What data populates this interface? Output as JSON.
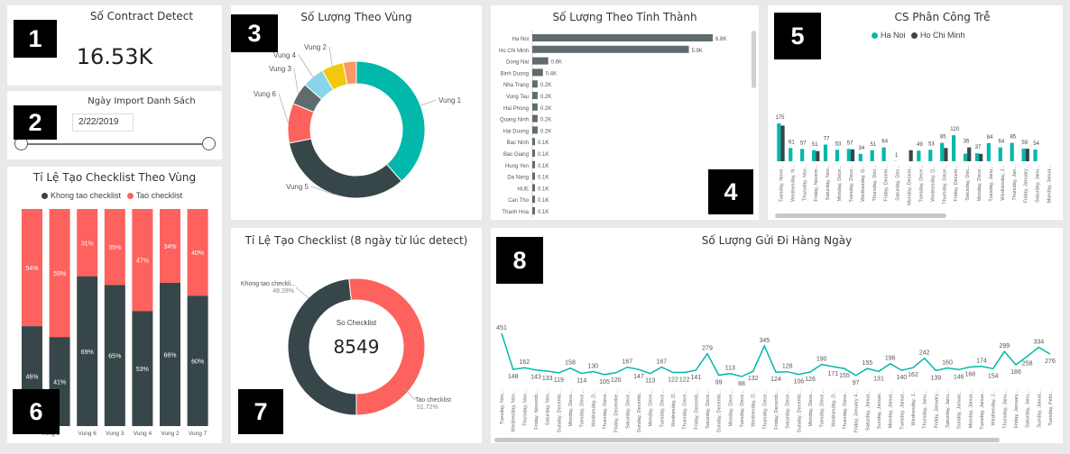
{
  "colors": {
    "teal": "#01B8AA",
    "dark": "#374649",
    "red": "#FD625E",
    "yellow": "#F2C80F",
    "lightblue": "#8AD4EB",
    "orange": "#FE9666",
    "grey": "#5F6B6D"
  },
  "badges": [
    "1",
    "2",
    "3",
    "4",
    "5",
    "6",
    "7",
    "8"
  ],
  "kpi": {
    "title": "Số Contract Detect",
    "value": "16.53K"
  },
  "slicer": {
    "title": "Ngày Import Danh Sách",
    "start_partial": "18",
    "end_date": "2/22/2019",
    "start_level": 0,
    "end_level": 1
  },
  "vung": {
    "title": "Số Lượng Theo Vùng",
    "chart_data": {
      "type": "pie",
      "labels": [
        "Vung 1",
        "Vung 5",
        "Vung 6",
        "Vung 3",
        "Vung 4",
        "Vung 2",
        "Vung 7"
      ],
      "values": [
        37,
        32,
        9,
        5,
        5,
        5,
        3
      ]
    }
  },
  "tinh": {
    "title": "Số Lượng Theo Tỉnh Thành",
    "chart_data": {
      "type": "bar",
      "categories": [
        "Ha Noi",
        "Ho Chi Minh",
        "Dong Nai",
        "Binh Duong",
        "Nha Trang",
        "Vung Tau",
        "Hai Phong",
        "Quang Ninh",
        "Hai Duong",
        "Bac Ninh",
        "Bac Giang",
        "Hung Yen",
        "Da Nang",
        "HUE",
        "Can Tho",
        "Thanh Hoa"
      ],
      "values": [
        6.8,
        5.9,
        0.6,
        0.4,
        0.2,
        0.2,
        0.2,
        0.2,
        0.2,
        0.1,
        0.1,
        0.1,
        0.1,
        0.1,
        0.1,
        0.1
      ],
      "labels": [
        "6.8K",
        "5.9K",
        "0.6K",
        "0.4K",
        "0.2K",
        "0.2K",
        "0.2K",
        "0.2K",
        "0.2K",
        "0.1K",
        "0.1K",
        "0.1K",
        "0.1K",
        "0.1K",
        "0.1K",
        "0.1K"
      ]
    }
  },
  "cs": {
    "title": "CS Phân Công Trễ",
    "chart_data": {
      "type": "bar",
      "legend": [
        "Ha Noi",
        "Ho Chi Minh"
      ],
      "categories": [
        "Tuesday, Nove...",
        "Wednesday, N...",
        "Thursday, Nov...",
        "Friday, Novem...",
        "Saturday, Nov...",
        "Monday, Dece...",
        "Tuesday, Dece...",
        "Wednesday, D...",
        "Thursday, Dec...",
        "Friday, Decem...",
        "Saturday, Dec...",
        "Monday, Decem...",
        "Tuesday, Dece...",
        "Wednesday, D...",
        "Thursday, Dece...",
        "Friday, Decem...",
        "Saturday, Dec...",
        "Monday, Dece...",
        "Tuesday, Janu...",
        "Wednesday, J...",
        "Thursday, Jan...",
        "Friday, January...",
        "Saturday, Janu...",
        "Monday, Janua..."
      ],
      "series": [
        {
          "name": "Ha Noi",
          "values": [
            175,
            61,
            57,
            51,
            77,
            53,
            57,
            34,
            51,
            64,
            1,
            0,
            49,
            53,
            85,
            120,
            35,
            37,
            84,
            64,
            85,
            59,
            54,
            0
          ]
        },
        {
          "name": "Ho Chi Minh",
          "values": [
            165,
            0,
            0,
            47,
            0,
            0,
            55,
            0,
            0,
            0,
            0,
            51,
            0,
            0,
            61,
            0,
            64,
            34,
            0,
            0,
            0,
            58,
            0,
            0
          ]
        }
      ],
      "labels": [
        "175",
        "61",
        "57",
        "51",
        "77",
        "53",
        "57",
        "34",
        "51",
        "64",
        "1",
        "",
        "49",
        "53",
        "85",
        "120",
        "35",
        "37",
        "84",
        "64",
        "85",
        "59",
        "54",
        ""
      ]
    }
  },
  "stacked": {
    "title": "Tỉ Lệ Tạo Checklist Theo Vùng",
    "legend": [
      "Khong tao checklist",
      "Tao checklist"
    ],
    "chart_data": {
      "type": "bar",
      "categories": [
        "Vung 1",
        "Vung 5",
        "Vung 6",
        "Vung 3",
        "Vung 4",
        "Vung 2",
        "Vung 7"
      ],
      "series": [
        {
          "name": "Khong tao checklist",
          "values": [
            46,
            41,
            69,
            65,
            53,
            66,
            60
          ]
        },
        {
          "name": "Tao checklist",
          "values": [
            54,
            59,
            31,
            35,
            47,
            34,
            40
          ]
        }
      ],
      "labels_bottom": [
        "46%",
        "41%",
        "69%",
        "65%",
        "53%",
        "66%",
        "60%"
      ],
      "labels_top": [
        "54%",
        "59%",
        "31%",
        "35%",
        "47%",
        "34%",
        "40%"
      ],
      "axis_labels": [
        "",
        "Vung 5",
        "Vung 6",
        "Vung 3",
        "Vung 4",
        "Vung 2",
        "Vung 7"
      ]
    }
  },
  "donut2": {
    "title": "Tỉ Lệ Tạo Checklist (8 ngày từ lúc detect)",
    "center_label": "So Checklist",
    "center_value": "8549",
    "chart_data": {
      "type": "pie",
      "labels": [
        "Khong tao checkli...",
        "Tao checklist"
      ],
      "values": [
        48.28,
        51.72
      ],
      "pct": [
        "48.28%",
        "51.72%"
      ]
    }
  },
  "daily": {
    "title": "Số Lượng Gửi Đi Hàng Ngày",
    "chart_data": {
      "type": "line",
      "values": [
        451,
        148,
        162,
        143,
        133,
        119,
        158,
        114,
        130,
        105,
        120,
        167,
        147,
        113,
        167,
        122,
        122,
        141,
        279,
        99,
        113,
        88,
        132,
        345,
        124,
        128,
        106,
        126,
        190,
        171,
        155,
        97,
        155,
        131,
        196,
        140,
        162,
        242,
        139,
        160,
        146,
        168,
        174,
        154,
        299,
        186,
        258,
        334,
        276
      ],
      "labels": [
        "451",
        "148",
        "162",
        "143",
        "133",
        "119",
        "158",
        "114",
        "130",
        "105",
        "120",
        "167",
        "147",
        "113",
        "167",
        "122",
        "122",
        "141",
        "279",
        "99",
        "113",
        "88",
        "132",
        "345",
        "124",
        "128",
        "106",
        "126",
        "190",
        "171",
        "155",
        "97",
        "155",
        "131",
        "196",
        "140",
        "162",
        "242",
        "139",
        "160",
        "146",
        "168",
        "174",
        "154",
        "299",
        "186",
        "258",
        "334",
        "276"
      ],
      "categories": [
        "Tuesday, Nov...",
        "Wednesday, Nov...",
        "Thursday, Nov...",
        "Friday, Novemb...",
        "Saturday, Nov...",
        "Sunday, Decemb...",
        "Monday, Dece...",
        "Tuesday, Dece...",
        "Wednesday, D...",
        "Thursday, Dece...",
        "Friday, Decembe...",
        "Saturday, Dece...",
        "Sunday, Decemb...",
        "Monday, Dece...",
        "Tuesday, Dece...",
        "Wednesday, D...",
        "Thursday, Dece...",
        "Friday, Decemb...",
        "Saturday, Dece...",
        "Sunday, Decemb...",
        "Monday, Dece...",
        "Tuesday, Dece...",
        "Wednesday, D...",
        "Thursday, Dece...",
        "Friday, Decemb...",
        "Saturday, Dece...",
        "Sunday, Decemb...",
        "Monday, Dece...",
        "Tuesday, Dece...",
        "Wednesday, D...",
        "Thursday, Dece...",
        "Friday, January 4...",
        "Saturday, Janua...",
        "Sunday, Januar...",
        "Monday, Janua...",
        "Tuesday, Janua...",
        "Wednesday, J...",
        "Thursday, Janu...",
        "Friday, January...",
        "Saturday, Janu...",
        "Sunday, Januar...",
        "Monday, Janua...",
        "Tuesday, Janua...",
        "Wednesday, J...",
        "Thursday, Janu...",
        "Friday, January...",
        "Saturday, Janu...",
        "Sunday, Janua...",
        "Tuesday, Febr..."
      ]
    }
  }
}
